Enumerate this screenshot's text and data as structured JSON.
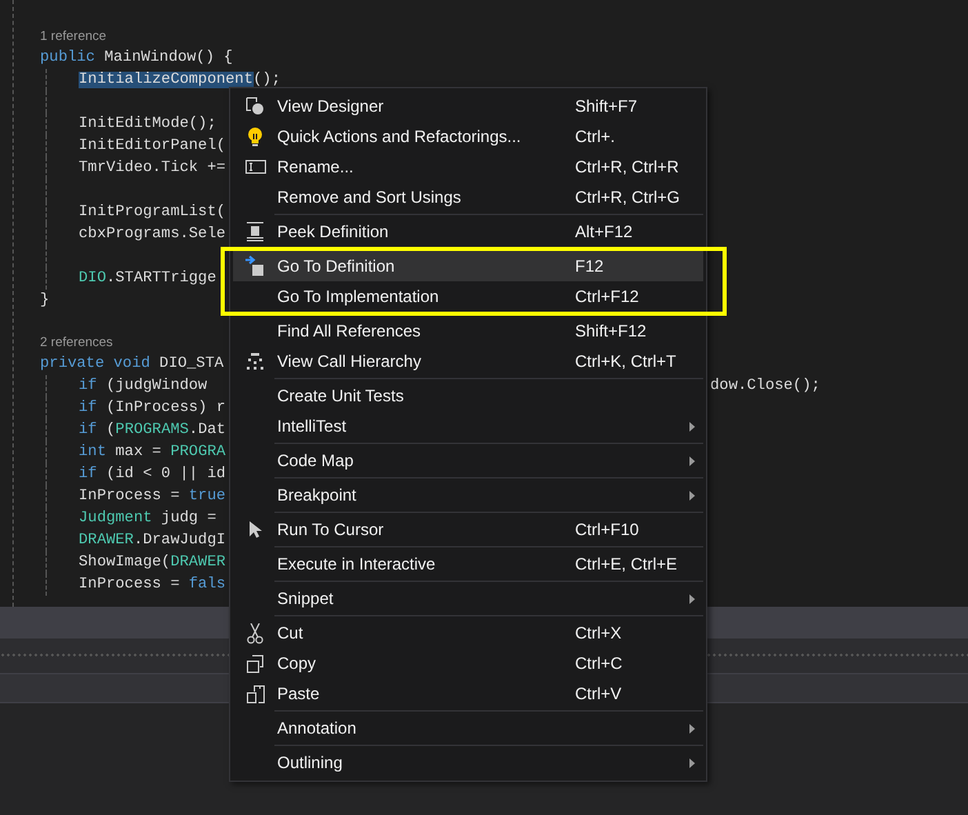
{
  "editor": {
    "blocks": [
      {
        "codelens": "1 reference",
        "signature": [
          {
            "t": "public",
            "kind": "keyword"
          },
          {
            "t": " MainWindow() {",
            "kind": "plain"
          }
        ],
        "body": [
          [
            {
              "tokens": [
                {
                  "t": "InitializeComponent",
                  "kind": "selected"
                },
                {
                  "t": "();",
                  "kind": "plain"
                }
              ]
            }
          ],
          [
            {
              "tokens": [
                {
                  "t": "InitEditMode();",
                  "kind": "plain"
                }
              ]
            },
            {
              "tokens": [
                {
                  "t": "InitEditorPanel(",
                  "kind": "plain"
                }
              ]
            },
            {
              "tokens": [
                {
                  "t": "TmrVideo.Tick +=",
                  "kind": "plain"
                }
              ]
            }
          ],
          [
            {
              "tokens": [
                {
                  "t": "InitProgramList(",
                  "kind": "plain"
                }
              ]
            },
            {
              "tokens": [
                {
                  "t": "cbxPrograms.Sele",
                  "kind": "plain"
                }
              ]
            }
          ],
          [
            {
              "tokens": [
                {
                  "t": "DIO",
                  "kind": "type"
                },
                {
                  "t": ".STARTTrigge",
                  "kind": "plain"
                }
              ]
            }
          ]
        ],
        "close": "}"
      },
      {
        "codelens": "2 references",
        "signature": [
          {
            "t": "private void",
            "kind": "keyword"
          },
          {
            "t": " DIO_STA",
            "kind": "plain"
          }
        ],
        "body": [
          [
            {
              "tokens": [
                {
                  "t": "if",
                  "kind": "keyword"
                },
                {
                  "t": " (judgWindow",
                  "kind": "plain"
                }
              ],
              "tail": "dow.Close();"
            },
            {
              "tokens": [
                {
                  "t": "if",
                  "kind": "keyword"
                },
                {
                  "t": " (InProcess) r",
                  "kind": "plain"
                }
              ]
            },
            {
              "tokens": [
                {
                  "t": "if",
                  "kind": "keyword"
                },
                {
                  "t": " (",
                  "kind": "plain"
                },
                {
                  "t": "PROGRAMS",
                  "kind": "type"
                },
                {
                  "t": ".Dat",
                  "kind": "plain"
                }
              ]
            },
            {
              "tokens": [
                {
                  "t": "int",
                  "kind": "keyword"
                },
                {
                  "t": " max = ",
                  "kind": "plain"
                },
                {
                  "t": "PROGRA",
                  "kind": "type"
                }
              ]
            },
            {
              "tokens": [
                {
                  "t": "if",
                  "kind": "keyword"
                },
                {
                  "t": " (id < 0 || id",
                  "kind": "plain"
                }
              ]
            },
            {
              "tokens": [
                {
                  "t": "InProcess = ",
                  "kind": "plain"
                },
                {
                  "t": "true",
                  "kind": "keyword"
                }
              ]
            },
            {
              "tokens": [
                {
                  "t": "Judgment",
                  "kind": "type"
                },
                {
                  "t": " judg =",
                  "kind": "plain"
                }
              ]
            },
            {
              "tokens": [
                {
                  "t": "DRAWER",
                  "kind": "type"
                },
                {
                  "t": ".DrawJudgI",
                  "kind": "plain"
                }
              ]
            },
            {
              "tokens": [
                {
                  "t": "ShowImage(",
                  "kind": "plain"
                },
                {
                  "t": "DRAWER",
                  "kind": "type"
                }
              ]
            },
            {
              "tokens": [
                {
                  "t": "InProcess = ",
                  "kind": "plain"
                },
                {
                  "t": "fals",
                  "kind": "keyword"
                }
              ]
            }
          ]
        ]
      }
    ]
  },
  "context_menu": {
    "groups": [
      [
        {
          "label": "View Designer",
          "shortcut": "Shift+F7",
          "selected": false
        },
        {
          "label": "Quick Actions and Refactorings...",
          "shortcut": "Ctrl+.",
          "selected": false
        },
        {
          "label": "Rename...",
          "shortcut": "Ctrl+R, Ctrl+R",
          "selected": false
        },
        {
          "label": "Remove and Sort Usings",
          "shortcut": "Ctrl+R, Ctrl+G",
          "selected": false
        }
      ],
      [
        {
          "label": "Peek Definition",
          "shortcut": "Alt+F12",
          "selected": false
        },
        {
          "label": "Go To Definition",
          "shortcut": "F12",
          "selected": true,
          "framed": true
        },
        {
          "label": "Go To Implementation",
          "shortcut": "Ctrl+F12",
          "selected": false,
          "framed": true
        },
        {
          "label": "Find All References",
          "shortcut": "Shift+F12",
          "selected": false
        },
        {
          "label": "View Call Hierarchy",
          "shortcut": "Ctrl+K, Ctrl+T",
          "selected": false
        }
      ],
      [
        {
          "label": "Create Unit Tests",
          "selected": false
        },
        {
          "label": "IntelliTest",
          "submenu": true,
          "selected": false
        }
      ],
      [
        {
          "label": "Code Map",
          "submenu": true,
          "selected": false
        }
      ],
      [
        {
          "label": "Breakpoint",
          "submenu": true,
          "selected": false
        }
      ],
      [
        {
          "label": "Run To Cursor",
          "shortcut": "Ctrl+F10",
          "selected": false
        }
      ],
      [
        {
          "label": "Execute in Interactive",
          "shortcut": "Ctrl+E, Ctrl+E",
          "selected": false
        }
      ],
      [
        {
          "label": "Snippet",
          "submenu": true,
          "selected": false
        }
      ],
      [
        {
          "label": "Cut",
          "shortcut": "Ctrl+X",
          "selected": false
        },
        {
          "label": "Copy",
          "shortcut": "Ctrl+C",
          "selected": false
        },
        {
          "label": "Paste",
          "shortcut": "Ctrl+V",
          "selected": false
        }
      ],
      [
        {
          "label": "Annotation",
          "submenu": true,
          "selected": false
        }
      ],
      [
        {
          "label": "Outlining",
          "submenu": true,
          "selected": false
        }
      ]
    ]
  }
}
